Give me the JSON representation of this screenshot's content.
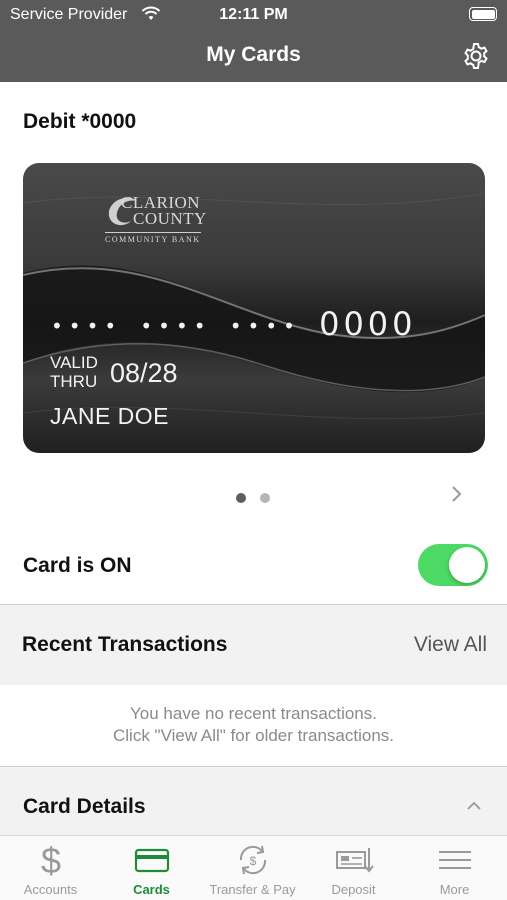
{
  "status_bar": {
    "carrier": "Service Provider",
    "time": "12:11 PM"
  },
  "nav": {
    "title": "My Cards",
    "settings_icon": "gear-icon"
  },
  "card": {
    "title": "Debit *0000",
    "bank_logo": {
      "line1": "CLARION",
      "line2": "COUNTY",
      "line3": "COMMUNITY BANK"
    },
    "masked_groups": [
      "••••",
      "••••",
      "••••"
    ],
    "last4": "0000",
    "valid_label_line1": "VALID",
    "valid_label_line2": "THRU",
    "expiry": "08/28",
    "holder": "JANE DOE"
  },
  "pager": {
    "count": 2,
    "active_index": 0
  },
  "card_toggle": {
    "label": "Card is ON",
    "on": true,
    "on_color": "#4cd964"
  },
  "recent_transactions": {
    "title": "Recent Transactions",
    "action": "View All",
    "empty_line1": "You have no recent transactions.",
    "empty_line2": "Click \"View All\" for older transactions."
  },
  "card_details": {
    "title": "Card Details",
    "expanded": true
  },
  "tabs": [
    {
      "label": "Accounts",
      "icon": "dollar-icon",
      "active": false
    },
    {
      "label": "Cards",
      "icon": "card-icon",
      "active": true
    },
    {
      "label": "Transfer & Pay",
      "icon": "transfer-icon",
      "active": false
    },
    {
      "label": "Deposit",
      "icon": "deposit-check-icon",
      "active": false
    },
    {
      "label": "More",
      "icon": "menu-icon",
      "active": false
    }
  ],
  "colors": {
    "header": "#5a5a5a",
    "accent": "#1e8a3a",
    "toggle_on": "#4cd964"
  }
}
